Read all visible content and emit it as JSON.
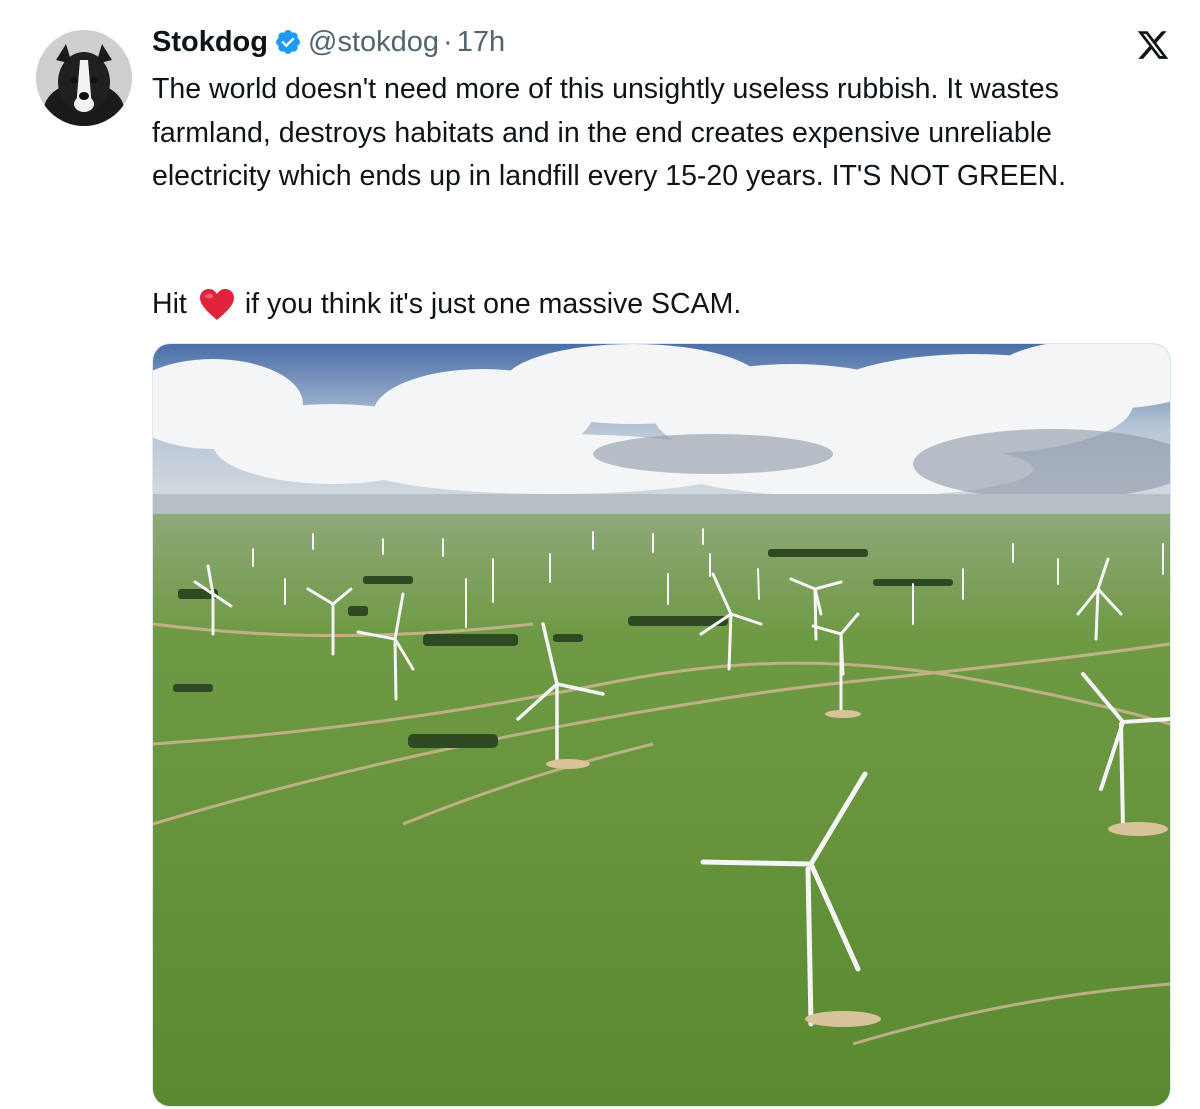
{
  "tweet": {
    "display_name": "Stokdog",
    "handle": "@stokdog",
    "separator": "·",
    "time": "17h",
    "body": "The world doesn't need more of this unsightly useless rubbish. It wastes farmland, destroys habitats and in the end creates expensive unreliable electricity which ends up in landfill every 15-20 years. IT'S NOT GREEN.",
    "cta_before": "Hit",
    "cta_after": "if you think it's just one massive SCAM.",
    "verified": true,
    "heart_icon": "red-heart-emoji",
    "media_description": "aerial-wind-farm-photo"
  },
  "colors": {
    "text": "#0f1419",
    "secondary": "#536471",
    "verified": "#1d9bf0",
    "heart": "#e0243c"
  }
}
